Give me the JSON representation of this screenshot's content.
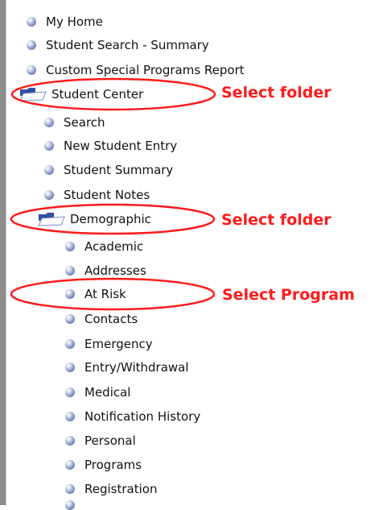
{
  "tree": {
    "top_items": [
      "My Home",
      "Student Search - Summary",
      "Custom Special Programs Report"
    ],
    "student_center": {
      "label": "Student Center",
      "children": [
        "Search",
        "New Student Entry",
        "Student Summary",
        "Student Notes"
      ],
      "demographic": {
        "label": "Demographic",
        "children": [
          "Academic",
          "Addresses",
          "At Risk",
          "Contacts",
          "Emergency",
          "Entry/Withdrawal",
          "Medical",
          "Notification History",
          "Personal",
          "Programs",
          "Registration"
        ]
      }
    }
  },
  "annotations": {
    "select_folder_1": "Select folder",
    "select_folder_2": "Select folder",
    "select_program": "Select Program"
  },
  "colors": {
    "annotation_red": "#ff1a1a",
    "folder_blue": "#2f4f9f",
    "border_gray": "#8e8e8e"
  },
  "icons": {
    "item": "sphere-bullet-icon",
    "folder": "open-folder-icon"
  }
}
